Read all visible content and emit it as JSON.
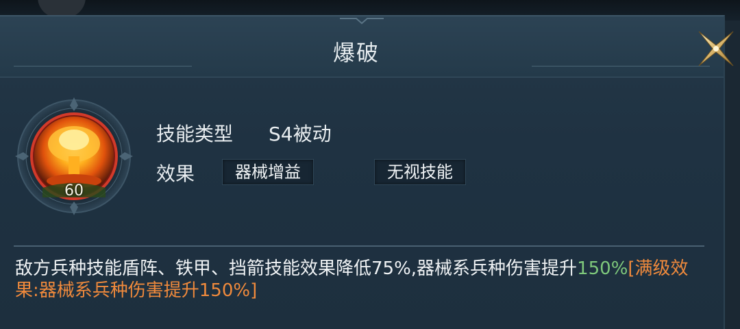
{
  "dialog": {
    "title": "爆破",
    "skill_type_label": "技能类型",
    "skill_type_value": "S4被动",
    "effect_label": "效果",
    "tags": [
      "器械增益",
      "无视技能"
    ],
    "level": "60",
    "description": {
      "main": "敌方兵种技能盾阵、铁甲、挡箭技能效果降低75%,器械系兵种伤害提升",
      "highlight": "150%",
      "max_level": "[满级效果:器械系兵种伤害提升150%]"
    }
  },
  "icons": {
    "skill": "explosion-icon",
    "close": "close-icon"
  },
  "colors": {
    "highlight": "#7fc97c",
    "max_level": "#f08a3c",
    "text": "#f0f3f5"
  }
}
